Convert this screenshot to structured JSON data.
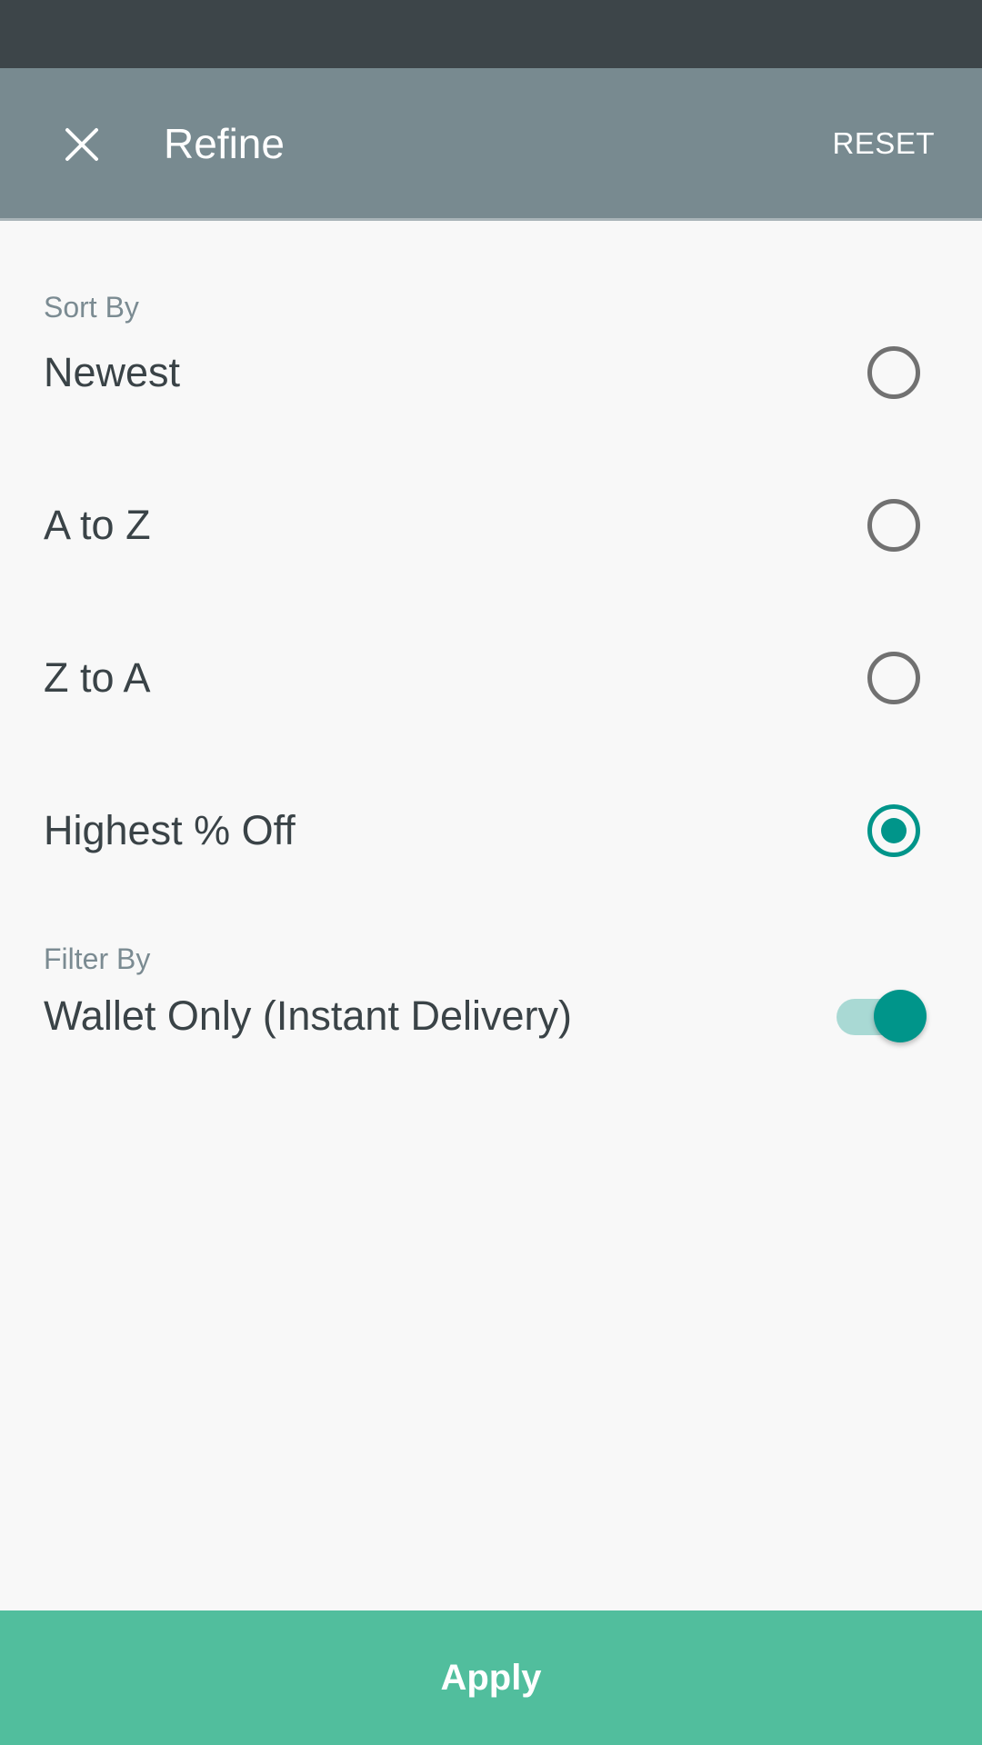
{
  "header": {
    "title": "Refine",
    "reset_label": "RESET",
    "close_icon": "close-icon"
  },
  "sort": {
    "section_label": "Sort By",
    "options": [
      {
        "label": "Newest",
        "selected": false
      },
      {
        "label": "A to Z",
        "selected": false
      },
      {
        "label": "Z to A",
        "selected": false
      },
      {
        "label": "Highest % Off",
        "selected": true
      }
    ]
  },
  "filter": {
    "section_label": "Filter By",
    "wallet_only": {
      "label": "Wallet Only (Instant Delivery)",
      "enabled": true
    }
  },
  "footer": {
    "apply_label": "Apply"
  },
  "colors": {
    "status_bar": "#3d4549",
    "app_bar": "#788a90",
    "accent": "#00958a",
    "apply_button": "#51be9d",
    "background": "#f8f8f8"
  }
}
